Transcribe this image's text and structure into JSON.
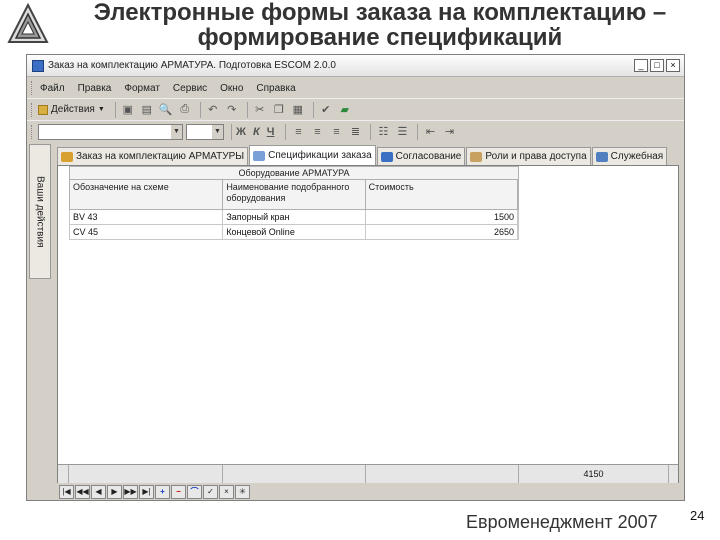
{
  "slide": {
    "title_line1": "Электронные формы заказа на комплектацию –",
    "title_line2": "формирование спецификаций",
    "brand": "Евроменеджмент 2007",
    "page_number": "24"
  },
  "window": {
    "title": "Заказ на комплектацию АРМАТУРА. Подготовка  ESCOM 2.0.0",
    "buttons": [
      "_",
      "□",
      "×"
    ]
  },
  "menu": [
    "Файл",
    "Правка",
    "Формат",
    "Сервис",
    "Окно",
    "Справка"
  ],
  "toolbar": {
    "actions_label": "Действия",
    "bold": "Ж",
    "italic": "К",
    "underline": "Ч"
  },
  "sidebar": {
    "label": "Ваши действия"
  },
  "tabs": [
    {
      "label": "Заказ на комплектацию АРМАТУРЫ",
      "color": "#d8a030"
    },
    {
      "label": "Спецификации заказа",
      "color": "#7aa0d8"
    },
    {
      "label": "Согласование",
      "color": "#3b6fc4"
    },
    {
      "label": "Роли и права доступа",
      "color": "#c8a060"
    },
    {
      "label": "Служебная",
      "color": "#5080c0"
    }
  ],
  "grid": {
    "group_header": "Оборудование АРМАТУРА",
    "columns": [
      "Обозначение на схеме",
      "Наименование подобранного оборудования",
      "Стоимость"
    ],
    "rows": [
      [
        "BV 43",
        "Запорный кран",
        "1500"
      ],
      [
        "CV 45",
        "Концевой Online",
        "2650"
      ]
    ],
    "total": "4150"
  },
  "nav": [
    "|◀",
    "◀◀",
    "◀",
    "▶",
    "▶▶",
    "▶|",
    "+",
    "−",
    "⌒",
    "✓",
    "×",
    "✳"
  ]
}
